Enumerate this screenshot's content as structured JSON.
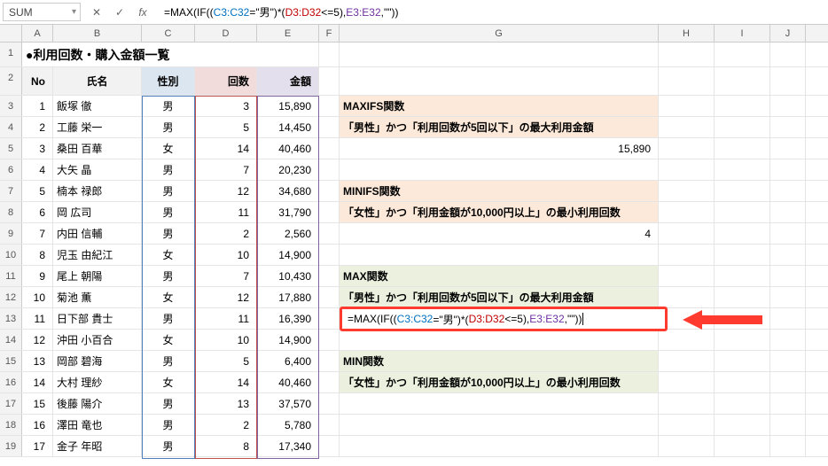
{
  "namebox": "SUM",
  "formula_tokens": [
    {
      "t": "=MAX(IF((",
      "cls": "tok-bk"
    },
    {
      "t": "C3:C32",
      "cls": "tok-bl"
    },
    {
      "t": "=\"男\")*(",
      "cls": "tok-bk"
    },
    {
      "t": "D3:D32",
      "cls": "tok-rd"
    },
    {
      "t": "<=5),",
      "cls": "tok-bk"
    },
    {
      "t": "E3:E32",
      "cls": "tok-pu"
    },
    {
      "t": ",\"\"))",
      "cls": "tok-bk"
    }
  ],
  "cols": [
    "A",
    "B",
    "C",
    "D",
    "E",
    "F",
    "G",
    "H",
    "I",
    "J"
  ],
  "title": "●利用回数・購入金額一覧",
  "headers": {
    "A": "No",
    "B": "氏名",
    "C": "性別",
    "D": "回数",
    "E": "金額"
  },
  "people": [
    {
      "r": 3,
      "no": 1,
      "name": "飯塚 徹",
      "sex": "男",
      "cnt": 3,
      "amt": "15,890"
    },
    {
      "r": 4,
      "no": 2,
      "name": "工藤 栄一",
      "sex": "男",
      "cnt": 5,
      "amt": "14,450"
    },
    {
      "r": 5,
      "no": 3,
      "name": "桑田 百華",
      "sex": "女",
      "cnt": 14,
      "amt": "40,460"
    },
    {
      "r": 6,
      "no": 4,
      "name": "大矢 晶",
      "sex": "男",
      "cnt": 7,
      "amt": "20,230"
    },
    {
      "r": 7,
      "no": 5,
      "name": "楠本 禄郎",
      "sex": "男",
      "cnt": 12,
      "amt": "34,680"
    },
    {
      "r": 8,
      "no": 6,
      "name": "岡 広司",
      "sex": "男",
      "cnt": 11,
      "amt": "31,790"
    },
    {
      "r": 9,
      "no": 7,
      "name": "内田 信輔",
      "sex": "男",
      "cnt": 2,
      "amt": "2,560"
    },
    {
      "r": 10,
      "no": 8,
      "name": "児玉 由紀江",
      "sex": "女",
      "cnt": 10,
      "amt": "14,900"
    },
    {
      "r": 11,
      "no": 9,
      "name": "尾上 朝陽",
      "sex": "男",
      "cnt": 7,
      "amt": "10,430"
    },
    {
      "r": 12,
      "no": 10,
      "name": "菊池 薫",
      "sex": "女",
      "cnt": 12,
      "amt": "17,880"
    },
    {
      "r": 13,
      "no": 11,
      "name": "日下部 貴士",
      "sex": "男",
      "cnt": 11,
      "amt": "16,390"
    },
    {
      "r": 14,
      "no": 12,
      "name": "沖田 小百合",
      "sex": "女",
      "cnt": 10,
      "amt": "14,900"
    },
    {
      "r": 15,
      "no": 13,
      "name": "岡部 碧海",
      "sex": "男",
      "cnt": 5,
      "amt": "6,400"
    },
    {
      "r": 16,
      "no": 14,
      "name": "大村 理紗",
      "sex": "女",
      "cnt": 14,
      "amt": "40,460"
    },
    {
      "r": 17,
      "no": 15,
      "name": "後藤 陽介",
      "sex": "男",
      "cnt": 13,
      "amt": "37,570"
    },
    {
      "r": 18,
      "no": 16,
      "name": "澤田 竜也",
      "sex": "男",
      "cnt": 2,
      "amt": "5,780"
    },
    {
      "r": 19,
      "no": 17,
      "name": "金子 年昭",
      "sex": "男",
      "cnt": 8,
      "amt": "17,340"
    }
  ],
  "gcol": {
    "3": {
      "txt": "MAXIFS関数",
      "hl": "or"
    },
    "4": {
      "txt": "「男性」かつ「利用回数が5回以下」の最大利用金額",
      "hl": "or"
    },
    "5": {
      "txt": "15,890",
      "num": true
    },
    "7": {
      "txt": "MINIFS関数",
      "hl": "or"
    },
    "8": {
      "txt": "「女性」かつ「利用金額が10,000円以上」の最小利用回数",
      "hl": "or"
    },
    "9": {
      "txt": "4",
      "num": true
    },
    "11": {
      "txt": "MAX関数",
      "hl": "gr"
    },
    "12": {
      "txt": "「男性」かつ「利用回数が5回以下」の最大利用金額",
      "hl": "gr"
    },
    "15": {
      "txt": "MIN関数",
      "hl": "gr"
    },
    "16": {
      "txt": "「女性」かつ「利用金額が10,000円以上」の最小利用回数",
      "hl": "gr"
    }
  },
  "edit_tokens": [
    {
      "t": "=MAX(IF((",
      "cls": "tok-bk"
    },
    {
      "t": "C3:C32",
      "cls": "tok-bl"
    },
    {
      "t": "=\"男\")*(",
      "cls": "tok-bk"
    },
    {
      "t": "D3:D32",
      "cls": "tok-rd"
    },
    {
      "t": "<=5),",
      "cls": "tok-bk"
    },
    {
      "t": "E3:E32",
      "cls": "tok-pu"
    },
    {
      "t": ",\"\"))",
      "cls": "tok-bk"
    }
  ]
}
